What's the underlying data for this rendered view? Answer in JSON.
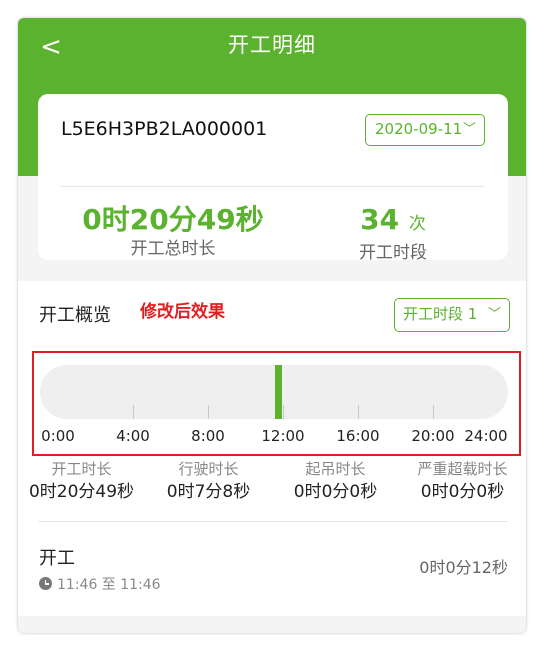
{
  "header": {
    "title": "开工明细",
    "back_glyph": "<",
    "color": "#5ab22e"
  },
  "summary": {
    "vin": "L5E6H3PB2LA000001",
    "date_select": {
      "value": "2020-09-11",
      "chevron": "﹀"
    },
    "total_duration": {
      "value": "0时20分49秒",
      "label": "开工总时长"
    },
    "segment_count": {
      "value": "34",
      "unit": "次",
      "label": "开工时段"
    }
  },
  "overview": {
    "title": "开工概览",
    "annotation": "修改后效果",
    "segment_select": {
      "value": "开工时段 1",
      "chevron": "﹀"
    },
    "timeline": {
      "range_hours": [
        0,
        24
      ],
      "active_segments": [
        {
          "start_hour": 11.77,
          "end_hour": 11.77
        }
      ],
      "tick_labels": [
        "0:00",
        "4:00",
        "8:00",
        "12:00",
        "16:00",
        "20:00",
        "24:00"
      ]
    },
    "metrics": [
      {
        "label": "开工时长",
        "value": "0时20分49秒"
      },
      {
        "label": "行驶时长",
        "value": "0时7分8秒"
      },
      {
        "label": "起吊时长",
        "value": "0时0分0秒"
      },
      {
        "label": "严重超载时长",
        "value": "0时0分0秒"
      }
    ]
  },
  "record": {
    "title": "开工",
    "time_range": "11:46 至 11:46",
    "duration": "0时0分12秒"
  },
  "colors": {
    "accent": "#5ab22e",
    "annotation": "#e02020"
  }
}
